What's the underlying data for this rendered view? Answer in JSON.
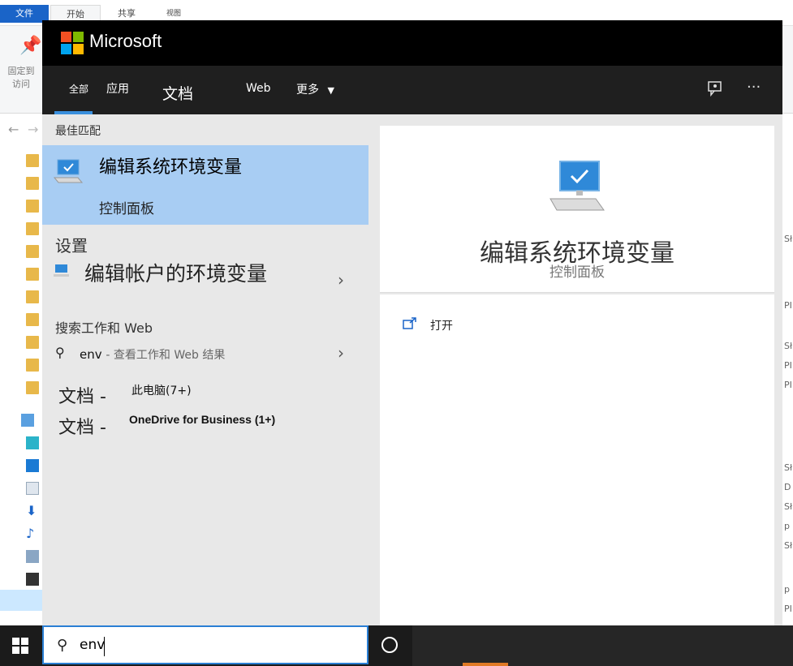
{
  "explorer": {
    "tabs": [
      "文件",
      "开始",
      "共享",
      "视图"
    ],
    "pin_label": "固定到\n访问",
    "right_col_letters": [
      "Sł",
      "PI",
      "Sł",
      "PI",
      "PI",
      "Sł",
      "D",
      "Sł",
      "p",
      "Sł",
      "p",
      "PI"
    ]
  },
  "start": {
    "brand": "Microsoft",
    "tabs": {
      "all": "全部",
      "apps": "应用",
      "docs": "文档",
      "web": "Web",
      "more": "更多"
    },
    "results": {
      "best_match_header": "最佳匹配",
      "best_match": {
        "title": "编辑系统环境变量",
        "subtitle": "控制面板"
      },
      "settings_header": "设置",
      "settings_item": "编辑帐户的环境变量",
      "search_header": "搜索工作和 Web",
      "search_item": {
        "query": "env",
        "hint": "- 查看工作和 Web 结果"
      },
      "documents": [
        {
          "label": "文档 -",
          "detail": "此电脑(7+)"
        },
        {
          "label": "文档 -",
          "detail": "OneDrive for Business (1+)"
        }
      ]
    },
    "preview": {
      "title": "编辑系统环境变量",
      "subtitle": "控制面板",
      "open_label": "打开"
    }
  },
  "taskbar": {
    "search_value": "env"
  },
  "colors": {
    "accent": "#2a7fd4",
    "best_match_bg": "#a8cdf3",
    "header_bg": "#000000"
  },
  "icons": [
    "pin-icon",
    "microsoft-logo",
    "feedback-icon",
    "more-icon",
    "monitor-icon",
    "chevron-right-icon",
    "search-icon",
    "open-icon",
    "windows-icon",
    "cortana-icon"
  ]
}
